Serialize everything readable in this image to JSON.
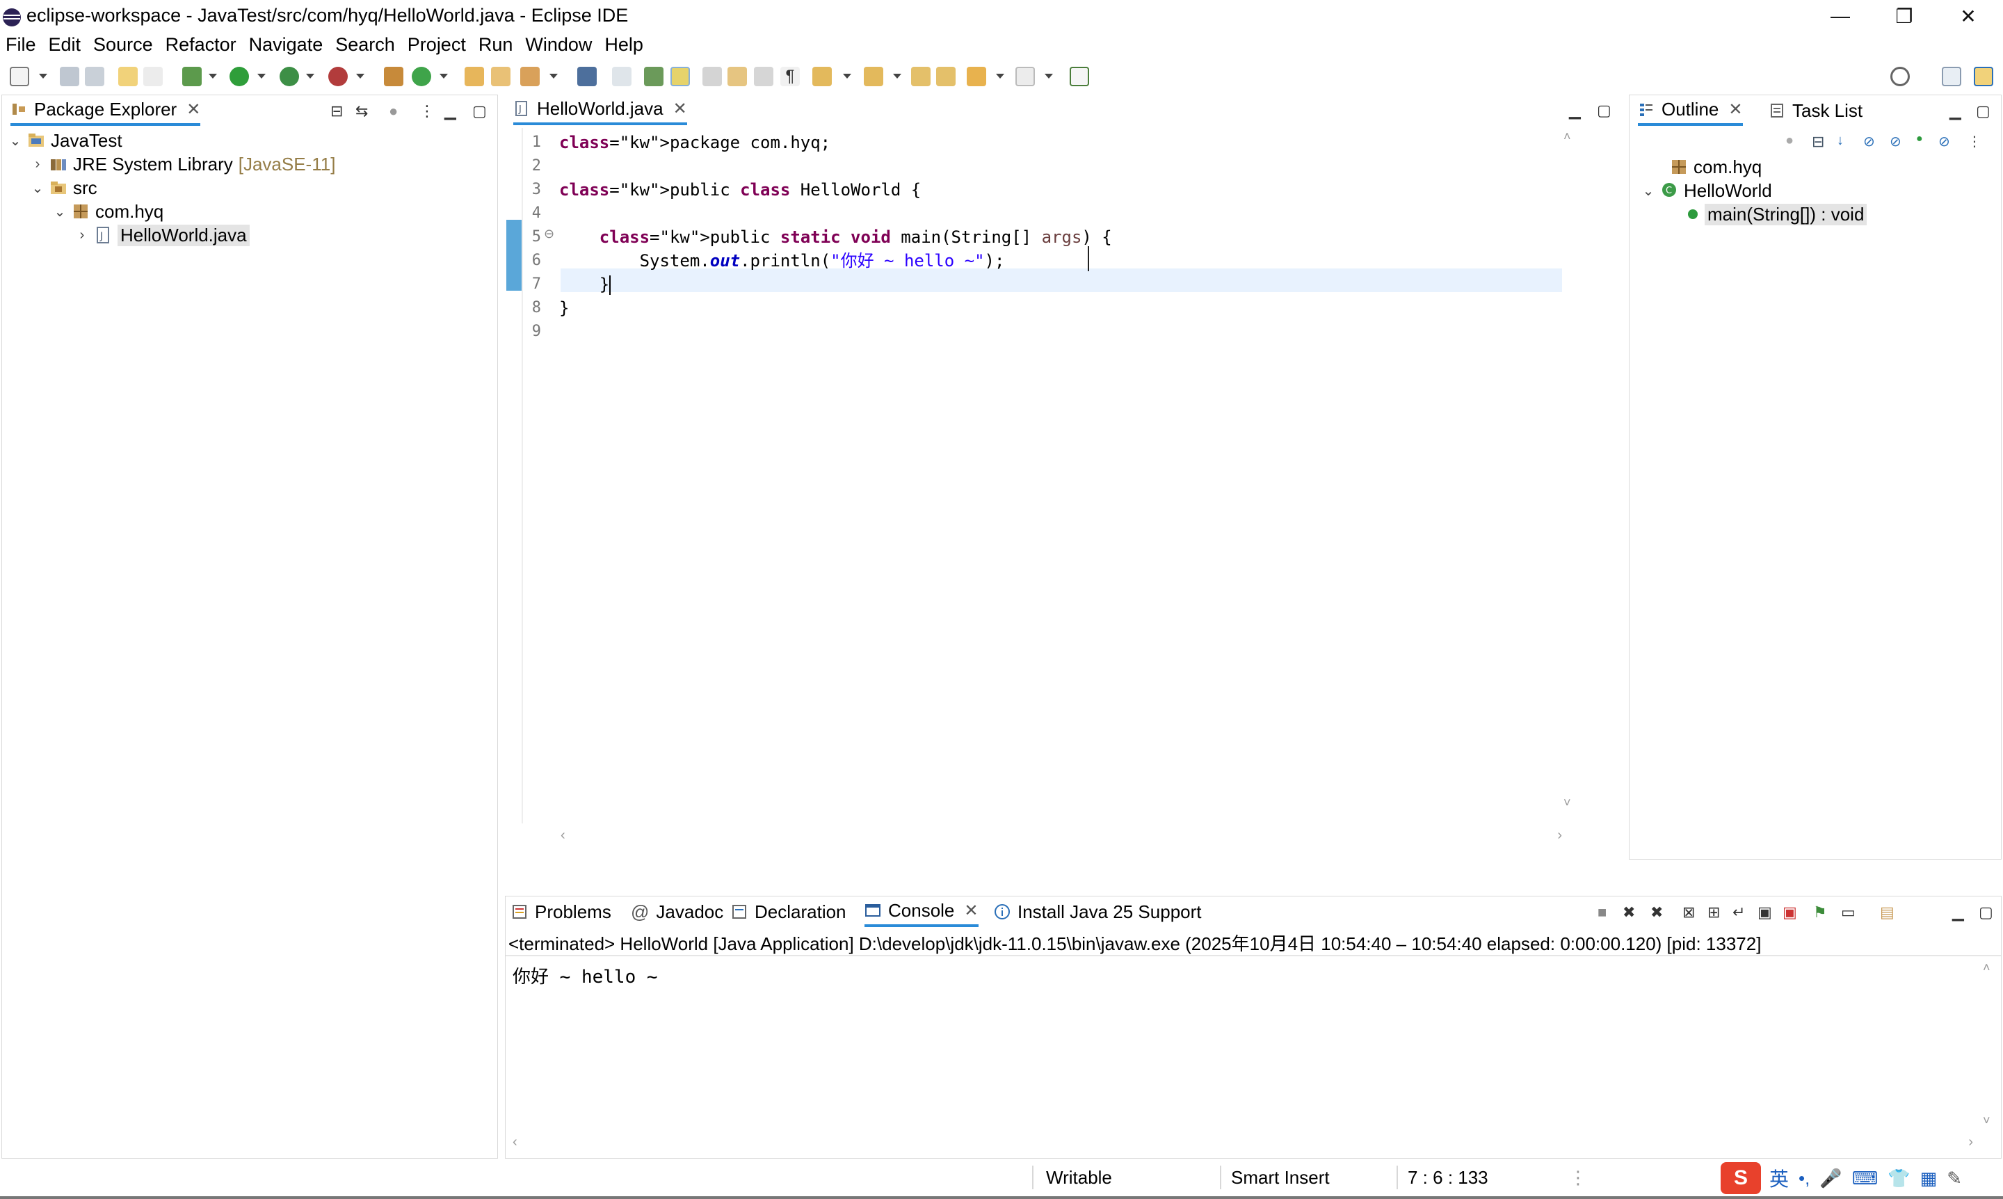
{
  "window": {
    "title": "eclipse-workspace - JavaTest/src/com/hyq/HelloWorld.java - Eclipse IDE",
    "minimize": "—",
    "restore": "❐",
    "close": "✕"
  },
  "menu": [
    "File",
    "Edit",
    "Source",
    "Refactor",
    "Navigate",
    "Search",
    "Project",
    "Run",
    "Window",
    "Help"
  ],
  "package_explorer": {
    "tab_label": "Package Explorer",
    "tree": [
      {
        "label": "JavaTest",
        "level": 0,
        "expanded": true,
        "icon": "project-icon"
      },
      {
        "label": "JRE System Library",
        "decoration": "[JavaSE-11]",
        "level": 1,
        "expanded": false,
        "icon": "library-icon"
      },
      {
        "label": "src",
        "level": 1,
        "expanded": true,
        "icon": "source-folder-icon"
      },
      {
        "label": "com.hyq",
        "level": 2,
        "expanded": true,
        "icon": "package-icon"
      },
      {
        "label": "HelloWorld.java",
        "level": 3,
        "expanded": false,
        "icon": "java-file-icon",
        "selected": true
      }
    ]
  },
  "editor": {
    "tab_label": "HelloWorld.java",
    "line_numbers": [
      "1",
      "2",
      "3",
      "4",
      "5",
      "6",
      "7",
      "8",
      "9"
    ],
    "lines": [
      "package com.hyq;",
      "",
      "public class HelloWorld {",
      "",
      "    public static void main(String[] args) {",
      "        System.out.println(\"你好 ~ hello ~\");",
      "    }",
      "}",
      ""
    ],
    "current_line": 7
  },
  "outline": {
    "tab_label": "Outline",
    "task_list_label": "Task List",
    "items": [
      {
        "label": "com.hyq",
        "icon": "package-icon"
      },
      {
        "label": "HelloWorld",
        "icon": "class-icon"
      },
      {
        "label": "main(String[]) : void",
        "icon": "public-method-icon",
        "selected": true
      }
    ]
  },
  "bottom": {
    "tabs": [
      "Problems",
      "Javadoc",
      "Declaration",
      "Console",
      "Install Java 25 Support"
    ],
    "active_tab": "Console",
    "console_header": "<terminated> HelloWorld [Java Application] D:\\develop\\jdk\\jdk-11.0.15\\bin\\javaw.exe  (2025年10月4日 10:54:40 – 10:54:40 elapsed: 0:00:00.120) [pid: 13372]",
    "console_output": "你好 ~ hello ~"
  },
  "status": {
    "writable": "Writable",
    "insert_mode": "Smart Insert",
    "position": "7 : 6 : 133",
    "ime_lang": "英"
  },
  "colors": {
    "accent": "#2a8bd8",
    "keyword": "#7f0055",
    "string": "#2a00ff",
    "line_highlight": "#e8f2fe"
  }
}
